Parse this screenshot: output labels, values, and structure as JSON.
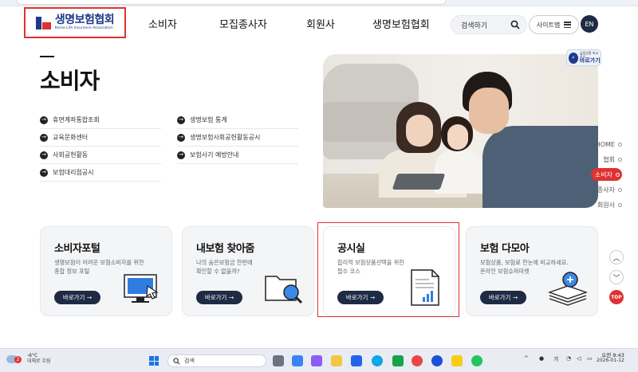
{
  "header": {
    "logo_title": "생명보험협회",
    "logo_subtitle": "Korea Life Insurance Association",
    "nav": [
      "소비자",
      "모집종사자",
      "회원사",
      "생명보험협회"
    ],
    "search_placeholder": "검색하기",
    "sitemap_label": "사이트맵",
    "lang_label": "EN"
  },
  "page": {
    "title": "소비자",
    "links_col1": [
      "휴면계좌통합조회",
      "교육문화센터",
      "사회공헌활동",
      "보험대리점공시"
    ],
    "links_col2": [
      "생명보험 통계",
      "생명보험사회공헌활동공시",
      "보험사기 예방안내"
    ]
  },
  "badge": {
    "line1": "금융상품 비교공시",
    "line2": "바로가기"
  },
  "side_nav": [
    {
      "label": "HOME",
      "active": false
    },
    {
      "label": "협회",
      "active": false
    },
    {
      "label": "소비자",
      "active": true
    },
    {
      "label": "종사자",
      "active": false
    },
    {
      "label": "회원사",
      "active": false
    }
  ],
  "cards": [
    {
      "title": "소비자포털",
      "desc": "생명보험이 어려운 보험소비자를 위한\n종합 정보 포털",
      "button": "바로가기 →",
      "icon": "monitor-cursor-icon"
    },
    {
      "title": "내보험 찾아줌",
      "desc": "나의 숨은보험금 한번에\n확인할 수 없을까?",
      "button": "바로가기 →",
      "icon": "folder-search-icon"
    },
    {
      "title": "공시실",
      "desc": "합리적 보험상품선택을 위한\n필수 코스",
      "button": "바로가기 →",
      "icon": "document-chart-icon"
    },
    {
      "title": "보험 다모아",
      "desc": "보험상품, 보험료 한눈에 비교하세요.\n온라인 보험슈퍼마켓",
      "button": "바로가기 →",
      "icon": "stack-search-icon"
    }
  ],
  "side_buttons": {
    "up": "︿",
    "down": "﹀",
    "top": "TOP"
  },
  "taskbar": {
    "weather_temp": "-6°C",
    "weather_desc": "대체로 흐림",
    "weather_badge": "2",
    "search_placeholder": "검색",
    "tray_ime": "가",
    "clock_time": "오전 9:43",
    "clock_date": "2026-01-12"
  },
  "colors": {
    "accent_red": "#e03131",
    "brand_navy": "#1e3a8a",
    "button_dark": "#1f2a44"
  }
}
